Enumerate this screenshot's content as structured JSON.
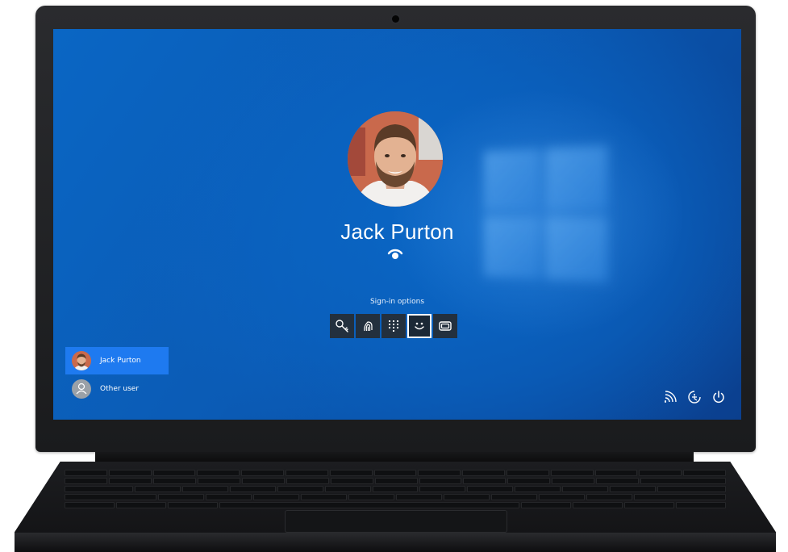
{
  "lock_screen": {
    "user_name": "Jack Purton",
    "sign_in_options_label": "Sign-in options",
    "sign_in_options": [
      {
        "name": "security-key",
        "icon": "key-icon"
      },
      {
        "name": "fingerprint",
        "icon": "fingerprint-icon"
      },
      {
        "name": "pin",
        "icon": "pin-keypad-icon"
      },
      {
        "name": "face",
        "icon": "face-icon",
        "selected": true
      },
      {
        "name": "smart-card",
        "icon": "smart-card-icon"
      }
    ]
  },
  "user_list": [
    {
      "label": "Jack Purton",
      "active": true
    },
    {
      "label": "Other user",
      "active": false
    }
  ],
  "tray": {
    "icons": [
      "network-icon",
      "ease-of-access-icon",
      "power-icon"
    ]
  },
  "colors": {
    "desktop_blue": "#0a5fbd",
    "active_user_highlight": "#1e7af0",
    "laptop_body": "#1c1d20"
  }
}
